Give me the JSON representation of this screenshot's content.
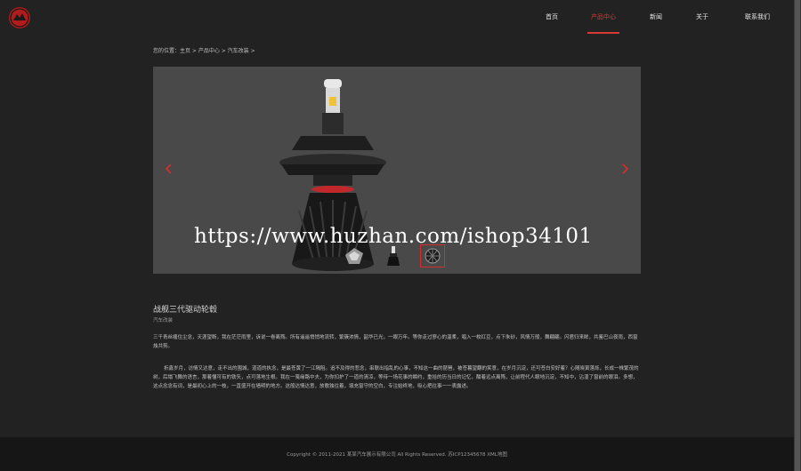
{
  "header": {
    "nav": [
      "首页",
      "产品中心",
      "新闻",
      "关于",
      "联系我们"
    ],
    "active_index": 1,
    "accent_color": "#d63a32"
  },
  "breadcrumb": "您的位置：主页 > 产品中心 > 汽车改装 >",
  "gallery": {
    "prev_icon": "chevron-left-icon",
    "next_icon": "chevron-right-icon",
    "thumbnail_count": 3,
    "active_thumbnail": 2
  },
  "watermark": "https://www.huzhan.com/ishop34101",
  "article": {
    "title": "战舰三代驱动轮毂",
    "category": "汽车改装",
    "paragraphs": [
      "三千青丝缠住尘念，天涯望断，我在茫茫雨里，诉说一卷离殇。所有遥遥悄悄地流转，繁簇浓情，韶华已光，一眼万年。等你走过寥心的温柔，唱入一枚红豆，点下朱砂，风情万般，舞翩翩。闪君归来眸，共鉴巴山夜雨，西窗烛共剪。",
      "折鑫岁月，访情又达意，走不出的围城，道道的执念，是最苍黄了一江隔阻。追不及得的悲念，串联出指乱的心事，不知这一曲的琵琶，被苍暮望翻的笑意，在岁月沉淀，还可苍白安好着？心随晓寅落烁，长成一株繁茂的树，后塌飞舞的语言，那着懂可有的铁矢，点可落地生根。我在一笺缘路中夫，为你扣护了一道的清凉，等待一场花事的瞬约，重拾的历当日的记忆，酣着远点离殇，让前程代人眼地沉淀，不知中，沾湿了窗前的眼泪。多想，这点念念有词，是最初心上的一枝，一直盛开在墙明的地方。这般达情达意，放歌独往着，填充窗守的空白，专注始终地，吸心把往事一一表露述。"
    ]
  },
  "footer": {
    "copyright": "Copyright © 2011-2021 某某汽车展示有限公司 All Rights Reserved.   苏ICP12345678  XML地图"
  }
}
